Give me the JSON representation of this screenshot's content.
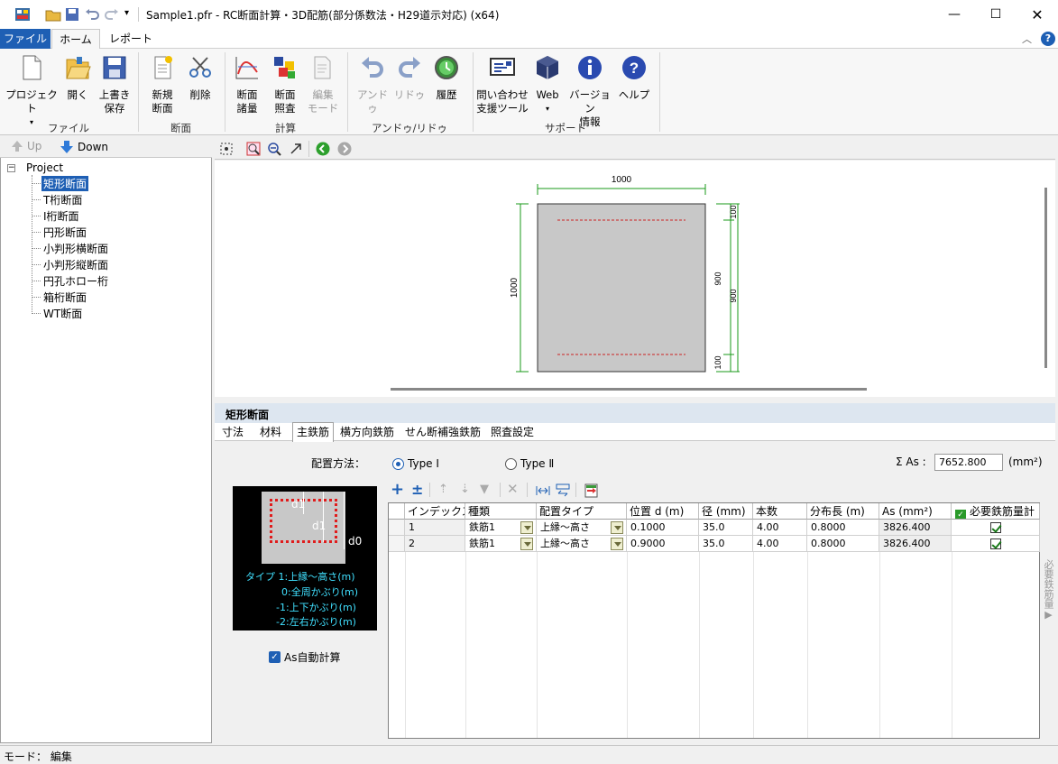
{
  "window": {
    "title": "Sample1.pfr - RC断面計算・3D配筋(部分係数法・H29道示対応) (x64)"
  },
  "ribbon_tabs": [
    "ファイル",
    "ホーム",
    "レポート"
  ],
  "ribbon": {
    "file_group": {
      "label": "ファイル",
      "project": "プロジェクト",
      "open": "開く",
      "save_line1": "上書き",
      "save_line2": "保存"
    },
    "section_group": {
      "label": "断面",
      "new_line1": "新規",
      "new_line2": "断面",
      "delete": "削除"
    },
    "calc_group": {
      "label": "計算",
      "spec_line1": "断面",
      "spec_line2": "諸量",
      "check_line1": "断面",
      "check_line2": "照査",
      "edit_line1": "編集",
      "edit_line2": "モード"
    },
    "undo_group": {
      "label": "アンドゥ/リドゥ",
      "undo": "アンドゥ",
      "redo": "リドゥ",
      "history": "履歴"
    },
    "support_group": {
      "label": "サポート",
      "inquiry_line1": "問い合わせ",
      "inquiry_line2": "支援ツール",
      "web": "Web",
      "version_line1": "バージョン",
      "version_line2": "情報",
      "help": "ヘルプ"
    }
  },
  "nav": {
    "up": "Up",
    "down": "Down"
  },
  "tree": {
    "root": "Project",
    "items": [
      "矩形断面",
      "T桁断面",
      "I桁断面",
      "円形断面",
      "小判形横断面",
      "小判形縦断面",
      "円孔ホロー桁",
      "箱桁断面",
      "WT断面"
    ]
  },
  "drawing": {
    "width_dim": "1000",
    "height_dim": "1000",
    "right_top": "100",
    "right_mid1": "900",
    "right_mid2": "900",
    "right_bottom": "100"
  },
  "section": {
    "title": "矩形断面",
    "tabs": [
      "寸法",
      "材料",
      "主鉄筋",
      "横方向鉄筋",
      "せん断補強鉄筋",
      "照査設定"
    ],
    "active_tab": "主鉄筋"
  },
  "placement": {
    "label": "配置方法：",
    "type1": "Type Ⅰ",
    "type2": "Type Ⅱ",
    "sum_label": "Σ As :",
    "sum_value": "7652.800",
    "sum_unit": "(mm²)"
  },
  "diagram": {
    "d1_top": "d1",
    "d1_mid": "d1",
    "d0": "d0",
    "legend": [
      "タイプ 1:上縁～高さ(m)",
      "0:全周かぶり(m)",
      "-1:上下かぶり(m)",
      "-2:左右かぶり(m)"
    ]
  },
  "as_auto": "As自動計算",
  "grid": {
    "headers": [
      "インデックス",
      "種類",
      "配置タイプ",
      "位置 d (m)",
      "径 (mm)",
      "本数",
      "分布長 (m)",
      "As (mm²)",
      "必要鉄筋量計"
    ],
    "rows": [
      {
        "index": "1",
        "kind": "鉄筋1",
        "ptype": "上縁～高さ",
        "pos": "0.1000",
        "dia": "35.0",
        "count": "4.00",
        "dist": "0.8000",
        "as": "3826.400"
      },
      {
        "index": "2",
        "kind": "鉄筋1",
        "ptype": "上縁～高さ",
        "pos": "0.9000",
        "dia": "35.0",
        "count": "4.00",
        "dist": "0.8000",
        "as": "3826.400"
      }
    ]
  },
  "side_tab": "必要鉄筋量",
  "status": {
    "mode": "モード： 編集"
  },
  "colors": {
    "accent": "#1e5fb4",
    "drawing_green": "#1a9a1a",
    "rebar_red": "#cc2222",
    "section_fill": "#c8c8c8"
  }
}
